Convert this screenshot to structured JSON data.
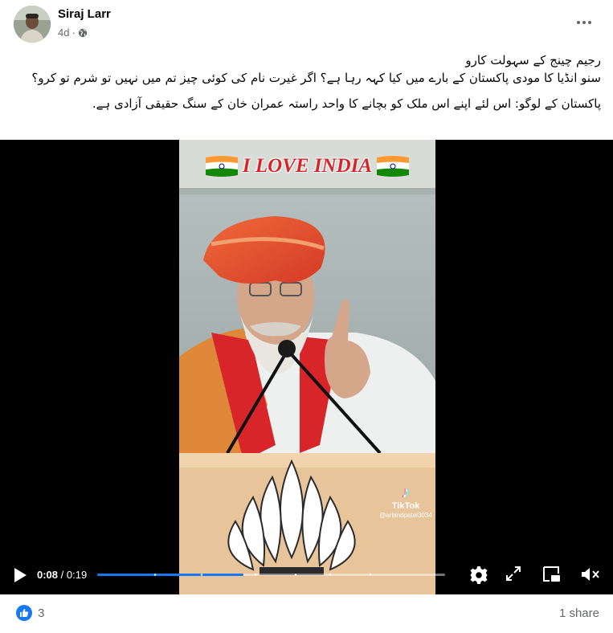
{
  "post": {
    "author": "Siraj Larr",
    "time": "4d",
    "privacy": "globe-icon",
    "caption_line1": "رجیم چینج کے سہولت کارو",
    "caption_line2": "سنو انڈیا کا مودی پاکستان کے بارے میں کیا کہہ رہا ہے؟ اگر غیرت نام کی کوئی چیز تم میں نہیں تو شرم تو کرو؟",
    "caption_line3": "پاکستان کے لوگو:  اس لئے اپنے اس ملک کو بچانے کا واحد راستہ عمران خان کے سنگ حقیقی آزادی ہے."
  },
  "video": {
    "overlay_text": "I  LOVE INDIA",
    "watermark_brand": "TikTok",
    "watermark_handle": "@arbindpatel3034",
    "current_time": "0:08",
    "separator": " / ",
    "duration": "0:19",
    "progress_fraction": 0.4211
  },
  "footer": {
    "reaction_count": "3",
    "share_text": "1 share"
  },
  "colors": {
    "accent": "#1877f2",
    "secondary_text": "#65676b"
  }
}
